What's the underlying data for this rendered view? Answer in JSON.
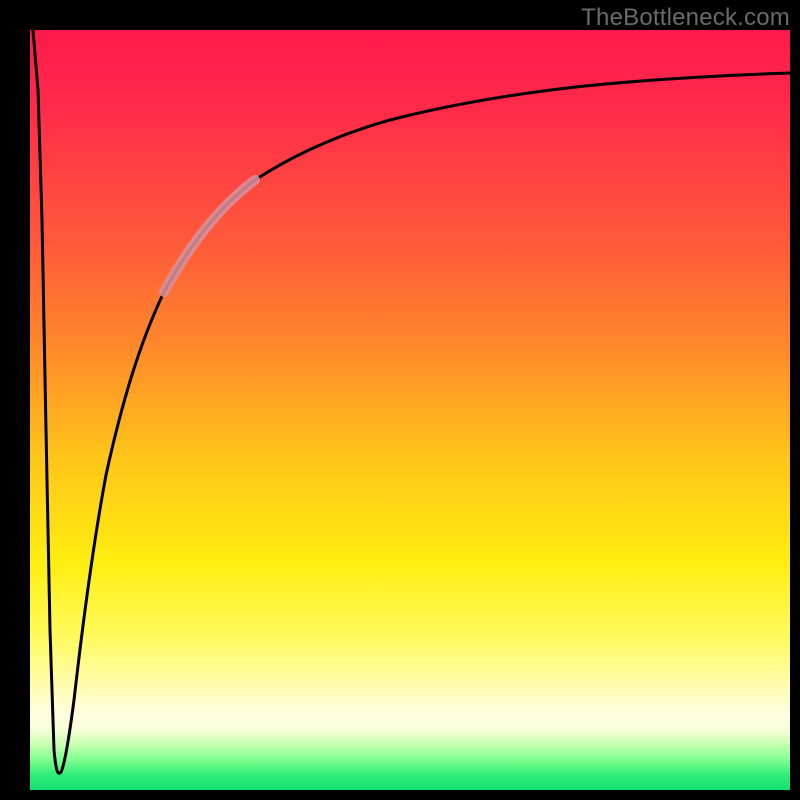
{
  "watermark": {
    "label": "TheBottleneck.com"
  },
  "chart_data": {
    "type": "line",
    "title": "",
    "xlabel": "",
    "ylabel": "",
    "xlim": [
      0,
      100
    ],
    "ylim": [
      0,
      100
    ],
    "grid": false,
    "legend": false,
    "background": "rainbow-vertical-gradient",
    "frame_color": "#000000",
    "series": [
      {
        "name": "bottleneck-curve",
        "color": "#000000",
        "x": [
          0.5,
          1.5,
          2.5,
          3.1,
          3.6,
          4.5,
          6,
          8,
          10,
          13,
          16,
          20,
          24,
          28,
          34,
          40,
          48,
          58,
          70,
          84,
          100
        ],
        "y": [
          100,
          55,
          15,
          3,
          2,
          10,
          27,
          44,
          55,
          64,
          70.5,
          76,
          79.5,
          82,
          85,
          87,
          89,
          90.5,
          91.7,
          92.5,
          93
        ]
      },
      {
        "name": "highlight-segment",
        "color": "#d98f9a",
        "stroke_width": 8,
        "opacity": 0.85,
        "x": [
          17,
          19,
          21,
          23,
          25,
          27,
          29
        ],
        "y": [
          71.8,
          74.2,
          76.2,
          77.9,
          79.3,
          80.5,
          81.6
        ]
      }
    ],
    "annotations": [
      {
        "text": "TheBottleneck.com",
        "position": "top-right",
        "color": "#6a6a6a"
      }
    ]
  }
}
